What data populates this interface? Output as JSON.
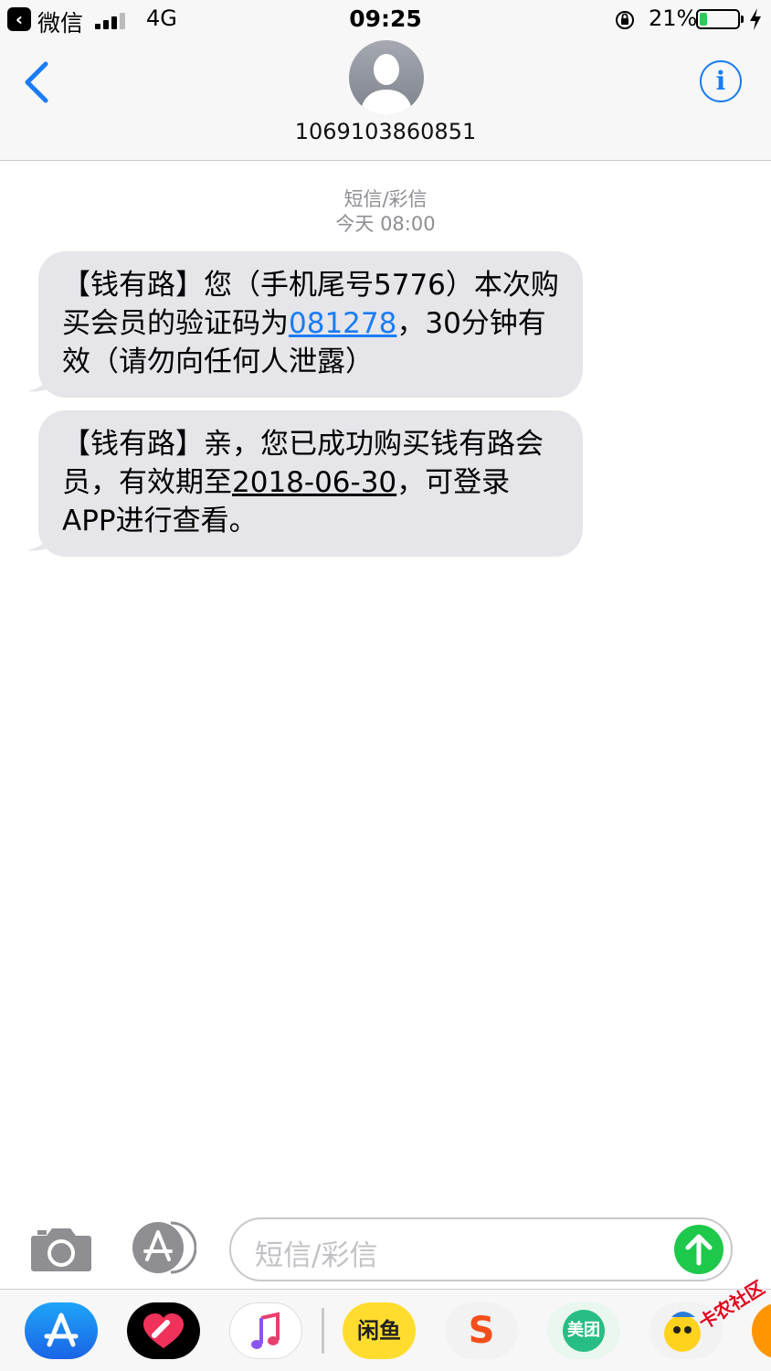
{
  "status_bar": {
    "back_app": "微信",
    "network": "4G",
    "time": "09:25",
    "battery_percent": "21%",
    "battery_level": 0.21
  },
  "header": {
    "contact": "1069103860851",
    "info_glyph": "i"
  },
  "thread": {
    "service_label": "短信/彩信",
    "timestamp": "今天 08:00",
    "messages": [
      {
        "pre": "【钱有路】您（手机尾号5776）本次购买会员的验证码为",
        "code": "081278",
        "post": "，30分钟有效（请勿向任何人泄露）"
      },
      {
        "pre": "【钱有路】亲，您已成功购买钱有路会员，有效期至",
        "date": "2018-06-30",
        "post": "，可登录APP进行查看。"
      }
    ]
  },
  "compose": {
    "placeholder": "短信/彩信"
  },
  "drawer": {
    "apps": [
      {
        "icon": "app-store-icon"
      },
      {
        "icon": "digital-touch-icon"
      },
      {
        "icon": "music-icon"
      },
      {
        "icon": "xianyu-icon",
        "label": "闲鱼"
      },
      {
        "icon": "sogou-icon",
        "label": "S"
      },
      {
        "icon": "meituan-icon",
        "label": "美团"
      },
      {
        "icon": "sticker-icon"
      }
    ],
    "watermark": "卡农社区"
  },
  "colors": {
    "accent": "#1a7cf5",
    "bubble": "#e5e5ea",
    "send": "#1ec84b"
  }
}
